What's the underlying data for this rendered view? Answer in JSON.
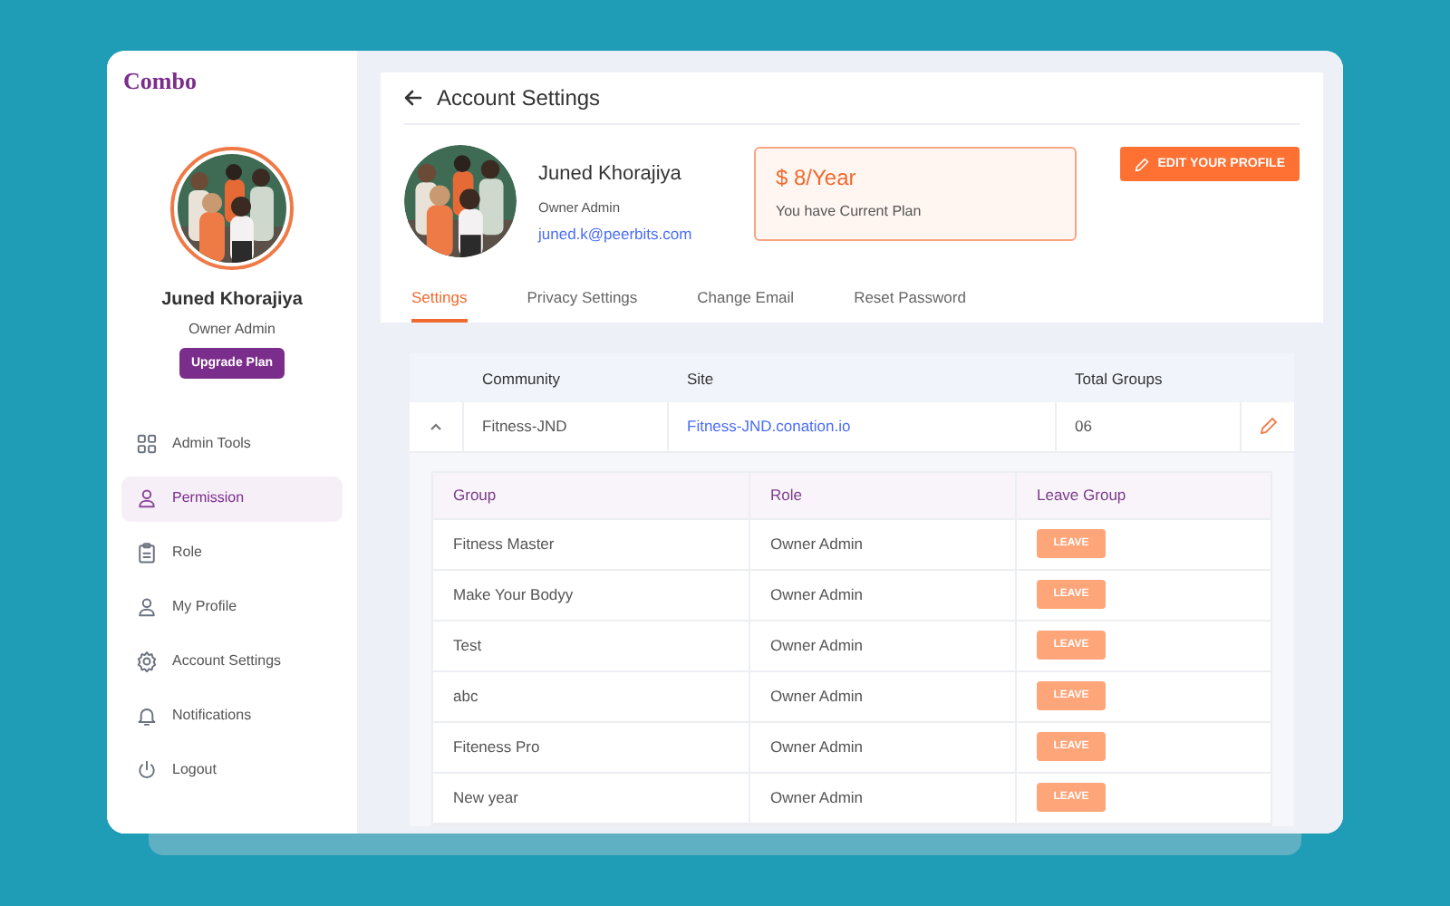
{
  "app": {
    "logo": "Combo"
  },
  "sidebar": {
    "profile": {
      "name": "Juned Khorajiya",
      "role": "Owner Admin"
    },
    "upgrade_button": "Upgrade Plan",
    "items": [
      {
        "label": "Admin Tools",
        "selected": false
      },
      {
        "label": "Permission",
        "selected": true
      },
      {
        "label": "Role",
        "selected": false
      },
      {
        "label": "My Profile",
        "selected": false
      },
      {
        "label": "Account Settings",
        "selected": false
      },
      {
        "label": "Notifications",
        "selected": false
      },
      {
        "label": "Logout",
        "selected": false
      }
    ]
  },
  "header": {
    "title": "Account Settings"
  },
  "profile": {
    "name": "Juned Khorajiya",
    "role": "Owner Admin",
    "email": "juned.k@peerbits.com"
  },
  "plan": {
    "price": "$ 8/Year",
    "note": "You have Current Plan"
  },
  "edit_button": "EDIT YOUR PROFILE",
  "tabs": [
    {
      "label": "Settings",
      "selected": true
    },
    {
      "label": "Privacy Settings",
      "selected": false
    },
    {
      "label": "Change Email",
      "selected": false
    },
    {
      "label": "Reset Password",
      "selected": false
    }
  ],
  "community_table": {
    "columns": [
      "Community",
      "Site",
      "Total Groups"
    ],
    "rows": [
      {
        "expanded": true,
        "community": "Fitness-JND",
        "site": "Fitness-JND.conation.io",
        "total_groups": "06",
        "groups": {
          "columns": [
            "Group",
            "Role",
            "Leave Group"
          ],
          "rows": [
            {
              "group": "Fitness Master",
              "role": "Owner Admin",
              "action": "LEAVE"
            },
            {
              "group": "Make Your Bodyy",
              "role": "Owner Admin",
              "action": "LEAVE"
            },
            {
              "group": "Test",
              "role": "Owner Admin",
              "action": "LEAVE"
            },
            {
              "group": "abc",
              "role": "Owner Admin",
              "action": "LEAVE"
            },
            {
              "group": "Fiteness Pro",
              "role": "Owner Admin",
              "action": "LEAVE"
            },
            {
              "group": "New year",
              "role": "Owner Admin",
              "action": "LEAVE"
            }
          ]
        }
      }
    ]
  }
}
